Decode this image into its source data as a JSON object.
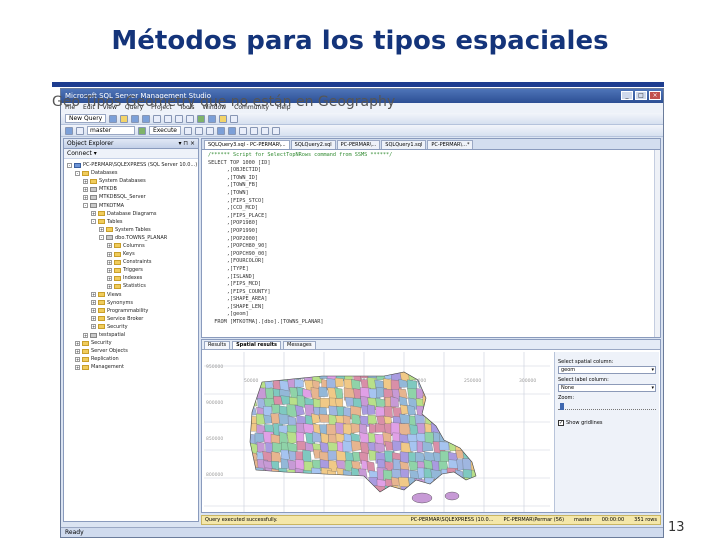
{
  "slide": {
    "title": "Métodos para los tipos espaciales",
    "subtitle": "Geo Tipos Geometry que no están en Geography",
    "page_number": "13"
  },
  "window": {
    "title": "Microsoft SQL Server Management Studio"
  },
  "menubar": [
    "File",
    "Edit",
    "View",
    "Query",
    "Project",
    "Tools",
    "Window",
    "Community",
    "Help"
  ],
  "toolbar": {
    "new_query": "New Query",
    "database": "master",
    "execute": "Execute"
  },
  "object_explorer": {
    "title": "Object Explorer",
    "connect": "Connect ▾",
    "tree": [
      {
        "label": "PC-PERMAR\\SQLEXPRESS (SQL Server 10.0...)",
        "depth": 0,
        "sign": "-",
        "kind": "srv"
      },
      {
        "label": "Databases",
        "depth": 1,
        "sign": "-",
        "kind": "fold"
      },
      {
        "label": "System Databases",
        "depth": 2,
        "sign": "+",
        "kind": "fold"
      },
      {
        "label": "MTKDB",
        "depth": 2,
        "sign": "+",
        "kind": "db"
      },
      {
        "label": "MTKDBSQL_Server",
        "depth": 2,
        "sign": "+",
        "kind": "db"
      },
      {
        "label": "MTKOTMA",
        "depth": 2,
        "sign": "-",
        "kind": "db"
      },
      {
        "label": "Database Diagrams",
        "depth": 3,
        "sign": "+",
        "kind": "fold"
      },
      {
        "label": "Tables",
        "depth": 3,
        "sign": "-",
        "kind": "fold"
      },
      {
        "label": "System Tables",
        "depth": 4,
        "sign": "+",
        "kind": "fold"
      },
      {
        "label": "dbo.TOWNS_PLANAR",
        "depth": 4,
        "sign": "-",
        "kind": "db"
      },
      {
        "label": "Columns",
        "depth": 5,
        "sign": "+",
        "kind": "fold"
      },
      {
        "label": "Keys",
        "depth": 5,
        "sign": "+",
        "kind": "fold"
      },
      {
        "label": "Constraints",
        "depth": 5,
        "sign": "+",
        "kind": "fold"
      },
      {
        "label": "Triggers",
        "depth": 5,
        "sign": "+",
        "kind": "fold"
      },
      {
        "label": "Indexes",
        "depth": 5,
        "sign": "+",
        "kind": "fold"
      },
      {
        "label": "Statistics",
        "depth": 5,
        "sign": "+",
        "kind": "fold"
      },
      {
        "label": "Views",
        "depth": 3,
        "sign": "+",
        "kind": "fold"
      },
      {
        "label": "Synonyms",
        "depth": 3,
        "sign": "+",
        "kind": "fold"
      },
      {
        "label": "Programmability",
        "depth": 3,
        "sign": "+",
        "kind": "fold"
      },
      {
        "label": "Service Broker",
        "depth": 3,
        "sign": "+",
        "kind": "fold"
      },
      {
        "label": "Security",
        "depth": 3,
        "sign": "+",
        "kind": "fold"
      },
      {
        "label": "testspatial",
        "depth": 2,
        "sign": "+",
        "kind": "db"
      },
      {
        "label": "Security",
        "depth": 1,
        "sign": "+",
        "kind": "fold"
      },
      {
        "label": "Server Objects",
        "depth": 1,
        "sign": "+",
        "kind": "fold"
      },
      {
        "label": "Replication",
        "depth": 1,
        "sign": "+",
        "kind": "fold"
      },
      {
        "label": "Management",
        "depth": 1,
        "sign": "+",
        "kind": "fold"
      }
    ]
  },
  "editor": {
    "tabs": [
      "SQLQuery3.sql - PC-PERMAR\\...",
      "SQLQuery2.sql",
      "PC-PERMAR\\...",
      "SQLQuery1.sql",
      "PC-PERMAR\\...*"
    ],
    "code_lines": [
      "/****** Script for SelectTopNRows command from SSMS ******/",
      "SELECT TOP 1000 [ID]",
      "      ,[OBJECTID]",
      "      ,[TOWN_ID]",
      "      ,[TOWN_FB]",
      "      ,[TOWN]",
      "      ,[FIPS_STCO]",
      "      ,[CCD_MCD]",
      "      ,[FIPS_PLACE]",
      "      ,[POP1980]",
      "      ,[POP1990]",
      "      ,[POP2000]",
      "      ,[POPCH80_90]",
      "      ,[POPCH90_00]",
      "      ,[FOURCOLOR]",
      "      ,[TYPE]",
      "      ,[ISLAND]",
      "      ,[FIPS_MCD]",
      "      ,[FIPS_COUNTY]",
      "      ,[SHAPE_AREA]",
      "      ,[SHAPE_LEN]",
      "      ,[geom]",
      "  FROM [MTKOTMA].[dbo].[TOWNS_PLANAR]"
    ]
  },
  "results": {
    "tabs": [
      "Results",
      "Spatial results",
      "Messages"
    ],
    "axis_labels": [
      "50000",
      "100000",
      "150000",
      "200000",
      "250000",
      "300000"
    ],
    "y_labels": [
      "950000",
      "900000",
      "850000",
      "800000"
    ],
    "options": {
      "spatial_column_label": "Select spatial column:",
      "spatial_column_value": "geom",
      "label_column_label": "Select label column:",
      "label_column_value": "None",
      "zoom_label": "Zoom:",
      "gridlines_label": "Show gridlines"
    }
  },
  "query_status": {
    "message": "Query executed successfully.",
    "server": "PC-PERMAR\\SQLEXPRESS (10.0...",
    "user": "PC-PERMAR\\Permar (56)",
    "db": "master",
    "time": "00:00:00",
    "rows": "351 rows"
  },
  "app_status": "Ready",
  "colors": {
    "title": "#14347a",
    "rule": "#1e3d8f",
    "status_ok": "#f4e7a9"
  }
}
